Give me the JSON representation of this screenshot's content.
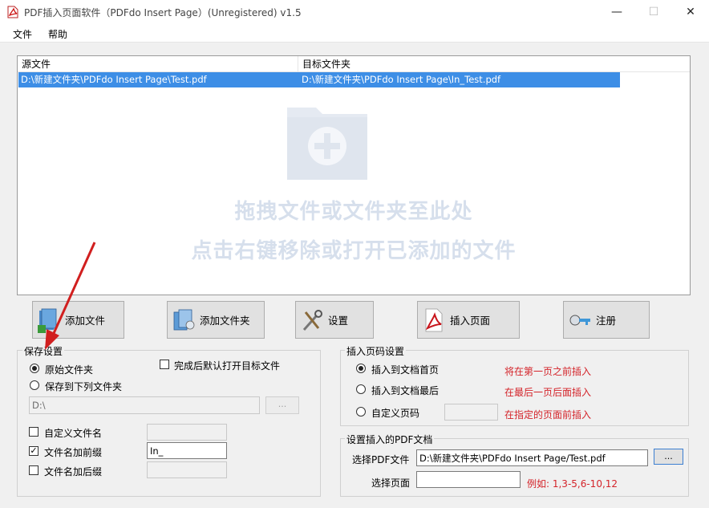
{
  "window": {
    "title": "PDF插入页面软件（PDFdo Insert Page）(Unregistered) v1.5",
    "minimize": "—",
    "maximize": "☐",
    "close": "✕"
  },
  "menu": {
    "file": "文件",
    "help": "帮助"
  },
  "list": {
    "columns": [
      "源文件",
      "目标文件夹"
    ],
    "rows": [
      {
        "source": "D:\\新建文件夹\\PDFdo Insert Page\\Test.pdf",
        "target": "D:\\新建文件夹\\PDFdo Insert Page\\In_Test.pdf"
      }
    ],
    "hint_line1": "拖拽文件或文件夹至此处",
    "hint_line2": "点击右键移除或打开已添加的文件"
  },
  "toolbar": {
    "add_file": "添加文件",
    "add_folder": "添加文件夹",
    "settings": "设置",
    "insert_page": "插入页面",
    "register": "注册"
  },
  "save_settings": {
    "title": "保存设置",
    "original_folder": "原始文件夹",
    "save_to_folder": "保存到下列文件夹",
    "open_after": "完成后默认打开目标文件",
    "folder_path": "D:\\",
    "browse": "...",
    "custom_name": "自定义文件名",
    "add_prefix": "文件名加前缀",
    "prefix_value": "In_",
    "add_suffix": "文件名加后缀"
  },
  "page_settings": {
    "title": "插入页码设置",
    "first_page": "插入到文档首页",
    "first_page_note": "将在第一页之前插入",
    "last_page": "插入到文档最后",
    "last_page_note": "在最后一页后面插入",
    "custom_page": "自定义页码",
    "custom_page_note": "在指定的页面前插入"
  },
  "insert_pdf": {
    "title": "设置插入的PDF文档",
    "select_file_label": "选择PDF文件",
    "file_value": "D:\\新建文件夹\\PDFdo Insert Page/Test.pdf",
    "browse": "...",
    "select_pages_label": "选择页面",
    "pages_value": "",
    "pages_example": "例如: 1,3-5,6-10,12"
  }
}
